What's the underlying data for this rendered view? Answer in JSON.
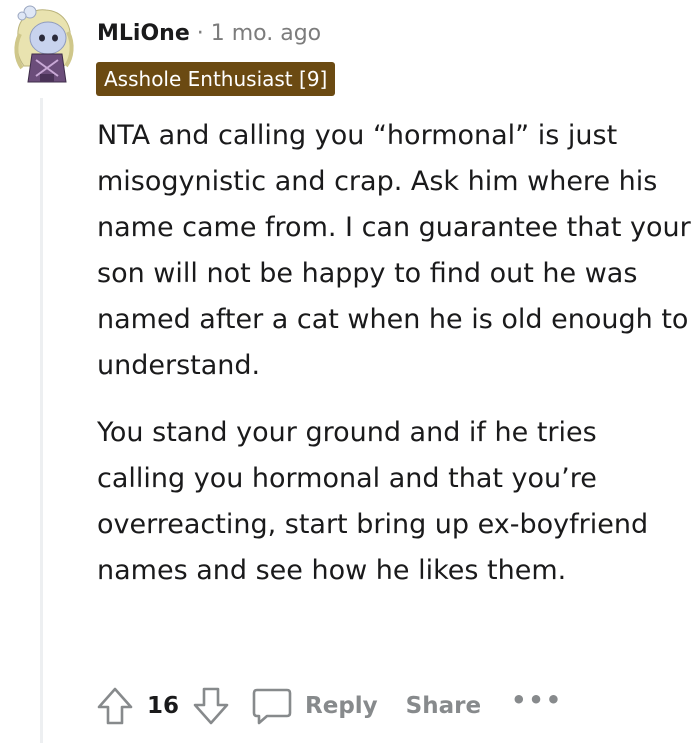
{
  "comment": {
    "username": "MLiOne",
    "separator": "·",
    "timestamp": "1 mo. ago",
    "flair": "Asshole Enthusiast [9]",
    "paragraphs": [
      "NTA and calling you “hormonal” is just misogynistic and crap. Ask him where his name came from. I can guarantee that your son will not be happy to find out he was named after a cat when he is old enough to understand.",
      "You stand your ground and if he tries calling you hormonal and that you’re overreacting, start bring up ex-boyfriend names and see how he likes them."
    ]
  },
  "actions": {
    "upvote_icon": "upvote-arrow-icon",
    "vote_count": "16",
    "downvote_icon": "downvote-arrow-icon",
    "reply_icon": "speech-bubble-icon",
    "reply_label": "Reply",
    "share_label": "Share",
    "more_label": "•••"
  },
  "colors": {
    "flair_bg": "#6b4a12",
    "muted": "#878a8c",
    "text": "#1a1a1b",
    "thread_line": "#edeff1"
  }
}
